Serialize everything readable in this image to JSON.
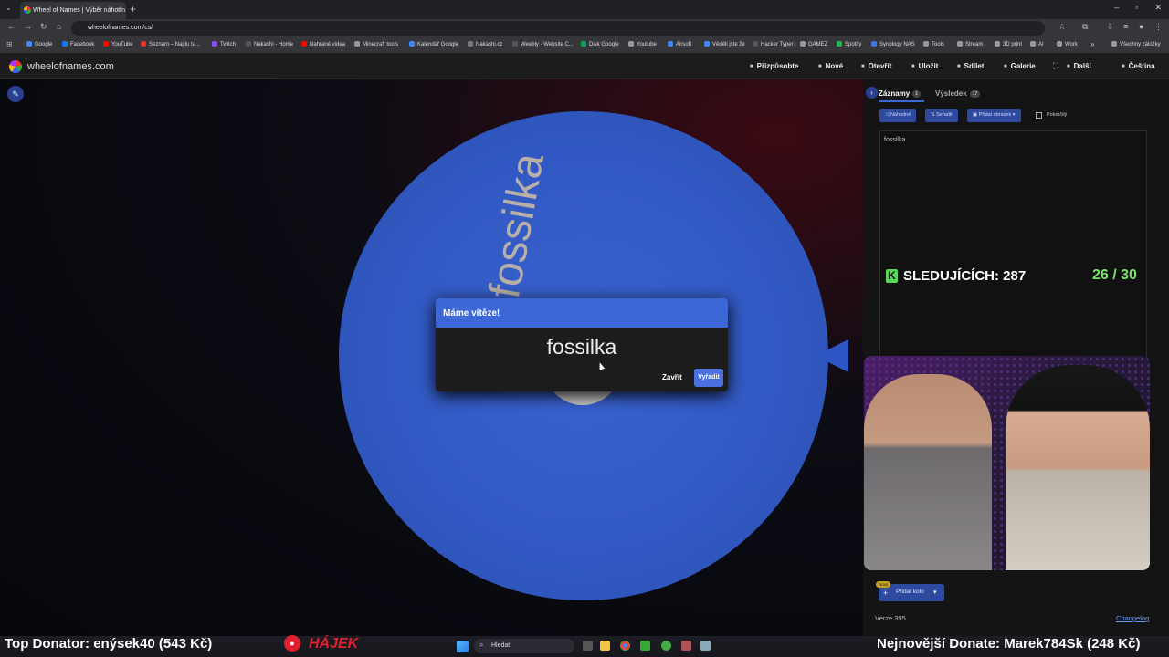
{
  "browser": {
    "tab_title": "Wheel of Names | Výběr náhodn",
    "url": "wheelofnames.com/cs/",
    "bookmarks": [
      "Google",
      "Facebook",
      "YouTube",
      "Seznam – Najdu ta...",
      "Twitch",
      "Nakashi - Home",
      "Nahrané videa",
      "Minecraft tools",
      "Kalendář Google",
      "Nakashi.cz",
      "Weebly - Website C...",
      "Disk Google",
      "Youtube",
      "Airsoft",
      "Věděli jste že",
      "Hacker Typer",
      "GAMEZ",
      "Spotify",
      "Synology NAS",
      "Tools",
      "Stream",
      "3D print",
      "AI",
      "Work"
    ],
    "more_bookmarks": "»",
    "all_bookmarks": "Všechny záložky"
  },
  "app": {
    "site_name": "wheelofnames.com",
    "menu": [
      "Přizpůsobte",
      "Nové",
      "Otevřít",
      "Uložit",
      "Sdílet",
      "Galerie",
      "Další",
      "Čeština"
    ]
  },
  "wheel": {
    "segment_label": "fossilka",
    "color": "#3158c2"
  },
  "dialog": {
    "title": "Máme vítěze!",
    "winner": "fossilka",
    "close_label": "Zavřít",
    "remove_label": "Vyřadit"
  },
  "panel": {
    "tabs": [
      {
        "label": "Záznamy",
        "count": "1"
      },
      {
        "label": "Výsledek",
        "count": "17"
      }
    ],
    "buttons": [
      "Náhodně",
      "Seřadit",
      "Přidat obrázek"
    ],
    "advanced_label": "Pokročilý",
    "entries": [
      "fossilka"
    ],
    "new_badge": "Nový",
    "add_wheel_label": "Přidat kolo",
    "version": "Verze 395",
    "changelog": "Changelog"
  },
  "overlay": {
    "followers_label": "SLEDUJÍCÍCH: 287",
    "goal": "26 / 30",
    "top_donator": "Top Donator: enýsek40  (543 Kč)",
    "streamer_name": "HÁJEK",
    "latest_donate": "Nejnovější Donate: Marek784Sk (248 Kč)"
  },
  "taskbar": {
    "search_placeholder": "Hledat"
  }
}
